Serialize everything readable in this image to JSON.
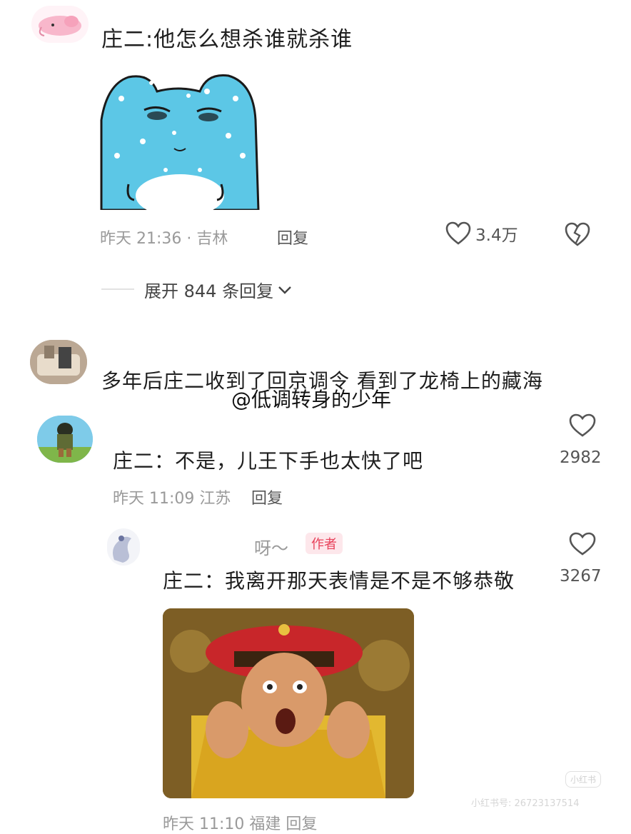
{
  "comment1": {
    "text": "庄二:他怎么想杀谁就杀谁",
    "meta": "昨天 21:36 · 吉林",
    "reply_label": "回复",
    "like_count": "3.4万",
    "expand_label": "展开 844 条回复"
  },
  "comment2": {
    "text": "多年后庄二收到了回京调令 看到了龙椅上的藏海"
  },
  "watermark": "@低调转身的少年",
  "reply1": {
    "text": "庄二：不是，儿王下手也太快了吧",
    "meta": "昨天 11:09 江苏",
    "reply_label": "回复",
    "like_count": "2982"
  },
  "reply2": {
    "username": "呀～",
    "author_tag": "作者",
    "text": "庄二：我离开那天表情是不是不够恭敬",
    "like_count": "3267",
    "meta_partial": "昨天 11:10 福建 回复"
  },
  "image_watermark": {
    "app": "小红书",
    "id": "小红书号: 26723137514"
  },
  "colors": {
    "accent": "#e8415a",
    "meta": "#9a9a9a",
    "sticker_blue": "#5cc7e6"
  }
}
